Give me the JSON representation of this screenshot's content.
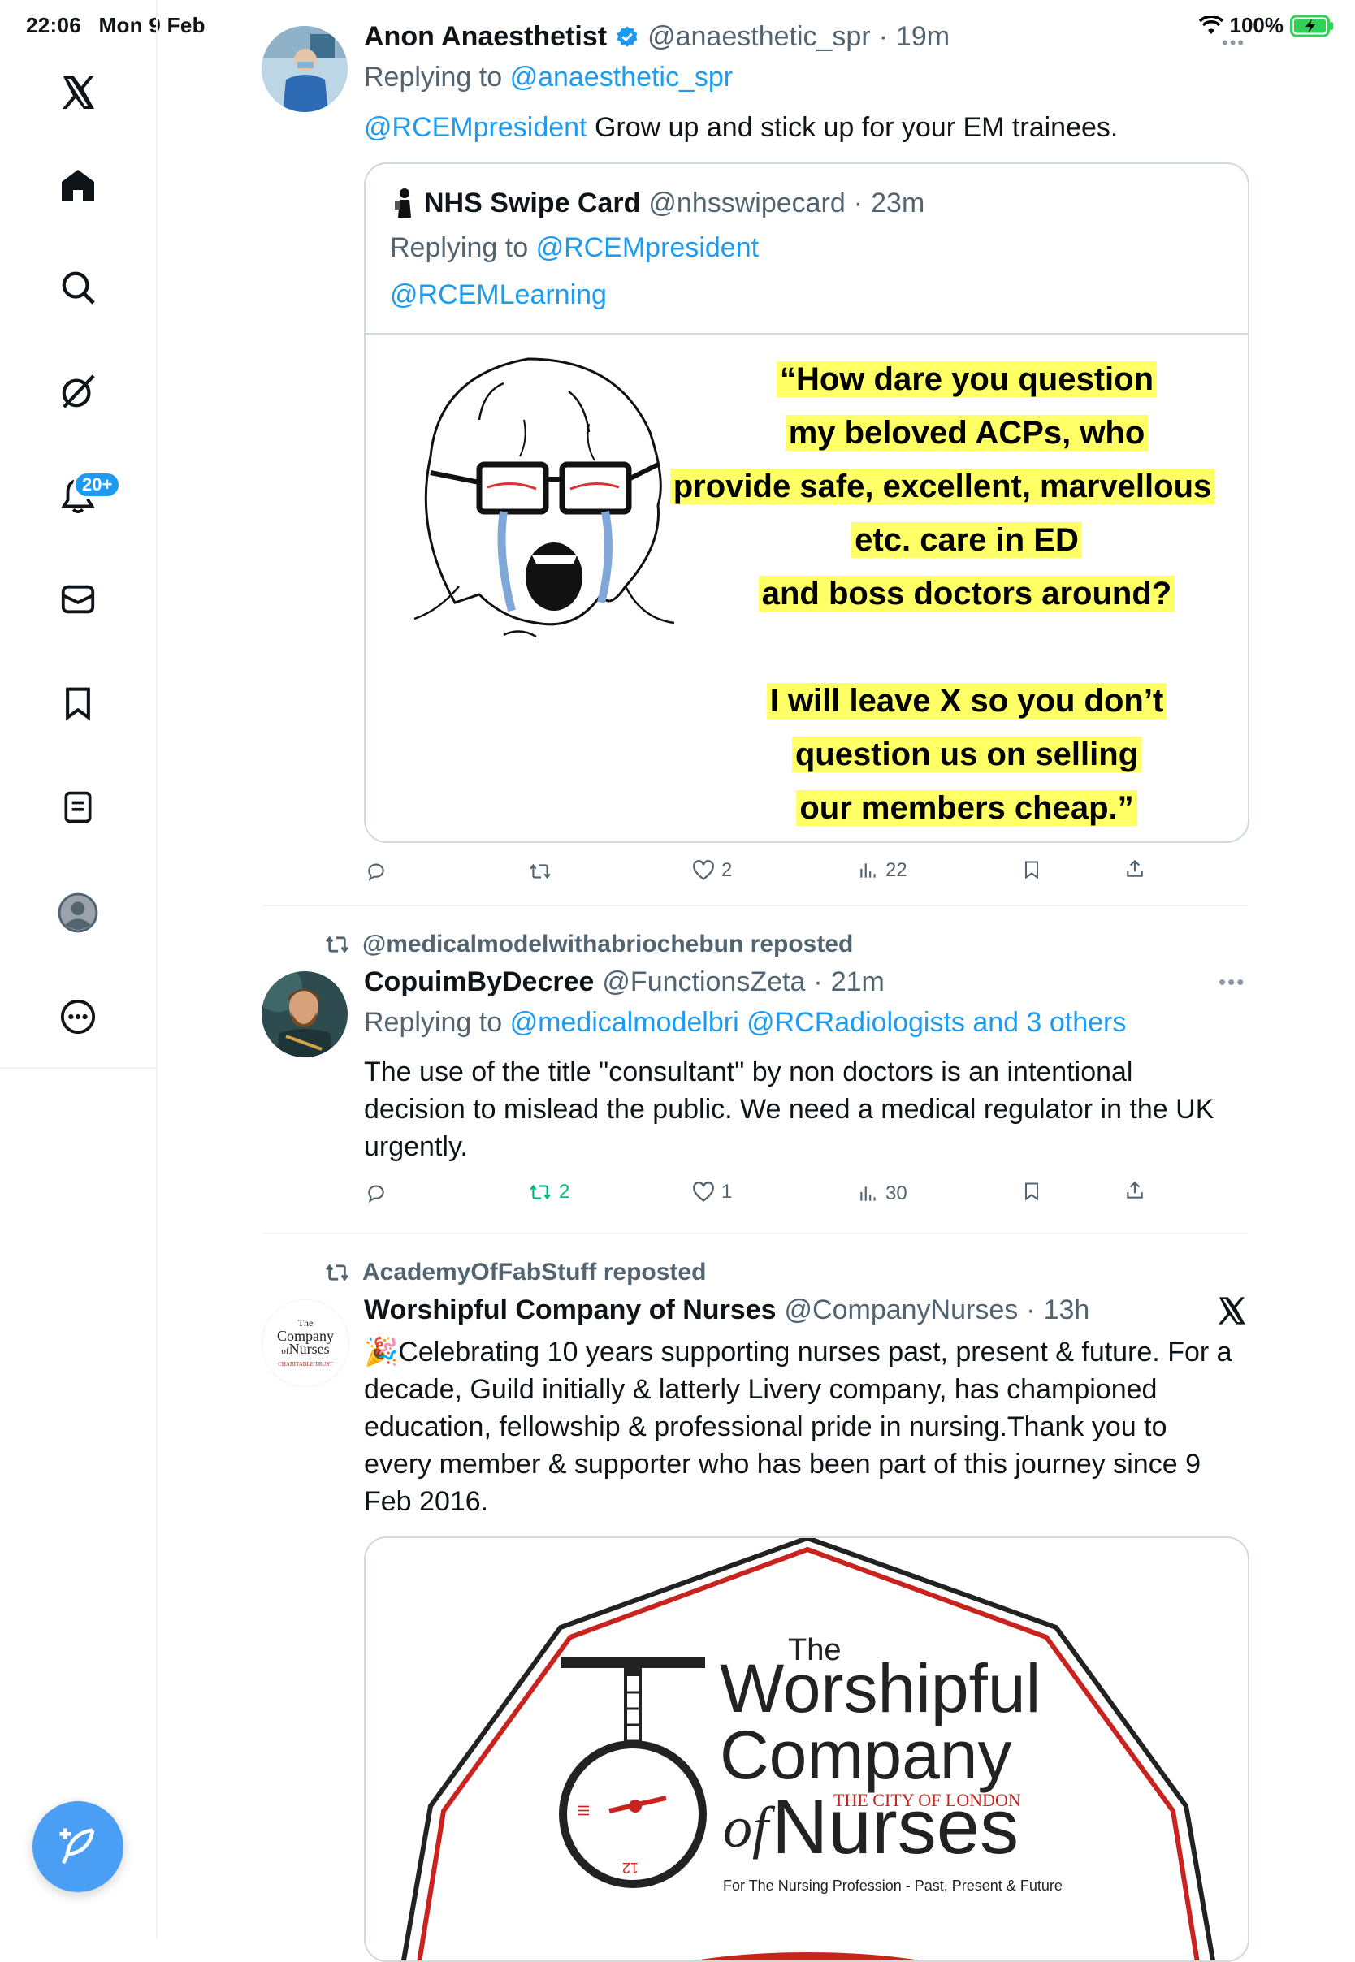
{
  "status_bar": {
    "time": "22:06",
    "date": "Mon 9 Feb",
    "battery": "100%"
  },
  "sidebar": {
    "notifications_badge": "20+",
    "items": [
      "home",
      "explore",
      "grok",
      "notifications",
      "messages",
      "bookmarks",
      "lists",
      "profile",
      "more"
    ]
  },
  "colors": {
    "accent": "#1d9bf0",
    "repost_green": "#00ba7c",
    "meme_highlight": "#ffff66"
  },
  "tweets": [
    {
      "name": "Anon Anaesthetist",
      "handle": "@anaesthetic_spr",
      "time": "19m",
      "replying_label": "Replying to",
      "replying_to": "@anaesthetic_spr",
      "mention": "@RCEMpresident",
      "text": " Grow up and stick up for your EM trainees.",
      "quote": {
        "name": "NHS Swipe Card",
        "handle": "@nhsswipecard",
        "time": "23m",
        "replying_label": "Replying to",
        "replying_to": "@RCEMpresident",
        "mention": "@RCEMLearning",
        "meme_lines": [
          "“How dare you question",
          "my beloved ACPs, who",
          "provide safe, excellent, marvellous",
          "etc. care in ED",
          "and boss doctors around?",
          "I will leave X so you don’t",
          "question us on selling",
          "our members cheap.”"
        ]
      },
      "actions": {
        "replies": "",
        "reposts": "",
        "likes": "2",
        "views": "22"
      }
    },
    {
      "repost_by": "@medicalmodelwithabriochebun reposted",
      "name": "CopuimByDecree",
      "handle": "@FunctionsZeta",
      "time": "21m",
      "replying_label": "Replying to",
      "replying_to": "@medicalmodelbri @RCRadiologists and 3 others",
      "text_lines": [
        "The use of the title \"consultant\" by non doctors is an intentional",
        "decision to mislead the public. We need a medical regulator in the UK",
        "urgently."
      ],
      "actions": {
        "replies": "",
        "reposts": "2",
        "likes": "1",
        "views": "30"
      }
    },
    {
      "repost_by": "AcademyOfFabStuff reposted",
      "name": "Worshipful Company of Nurses",
      "handle": "@CompanyNurses",
      "time": "13h",
      "text_lines": [
        "🎉Celebrating 10 years supporting nurses past, present & future. For a",
        "decade, Guild initially & latterly Livery company, has championed",
        "education, fellowship & professional pride in nursing.Thank you to",
        "every member & supporter who has been part of this journey since 9",
        "Feb 2016."
      ],
      "media": {
        "the": "The",
        "worshipful": "Worshipful",
        "company": "Company",
        "of": "of",
        "nurses": "Nurses",
        "city": "THE CITY OF LONDON",
        "tagline": "For The Nursing Profession - Past, Present & Future",
        "clock_12": "12",
        "clock_3": "III"
      },
      "avatar_logo": {
        "the": "The",
        "company": "Company",
        "of": "of",
        "nurses": "Nurses",
        "trust": "CHARITABLE TRUST"
      }
    }
  ]
}
